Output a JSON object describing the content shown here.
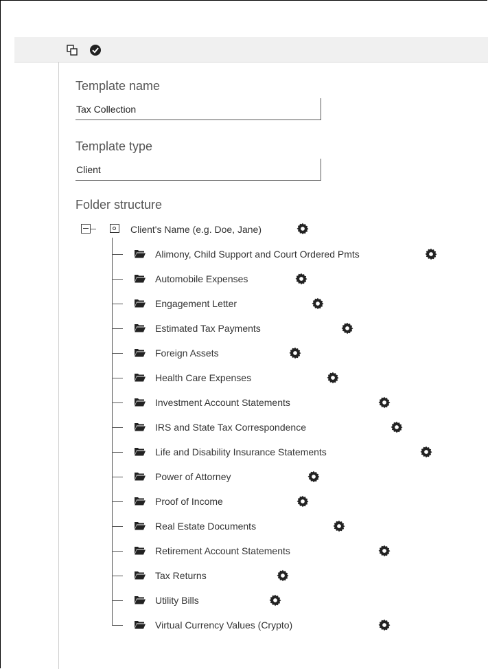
{
  "toolbar": {
    "icons": [
      "copy-icon",
      "check-circle-icon"
    ]
  },
  "form": {
    "template_name_label": "Template name",
    "template_name_value": "Tax Collection",
    "template_type_label": "Template type",
    "template_type_value": "Client",
    "folder_structure_label": "Folder structure"
  },
  "tree": {
    "root_label": "Client's Name (e.g. Doe, Jane)",
    "children": [
      "Alimony, Child Support and Court Ordered Pmts",
      "Automobile Expenses",
      "Engagement Letter",
      "Estimated Tax Payments",
      "Foreign Assets",
      "Health Care Expenses",
      "Investment Account Statements",
      "IRS and State Tax Correspondence",
      "Life and Disability Insurance Statements",
      "Power of Attorney",
      "Proof of Income",
      "Real Estate Documents",
      "Retirement Account Statements",
      "Tax Returns",
      "Utility Bills",
      "Virtual Currency Values (Crypto)"
    ]
  }
}
